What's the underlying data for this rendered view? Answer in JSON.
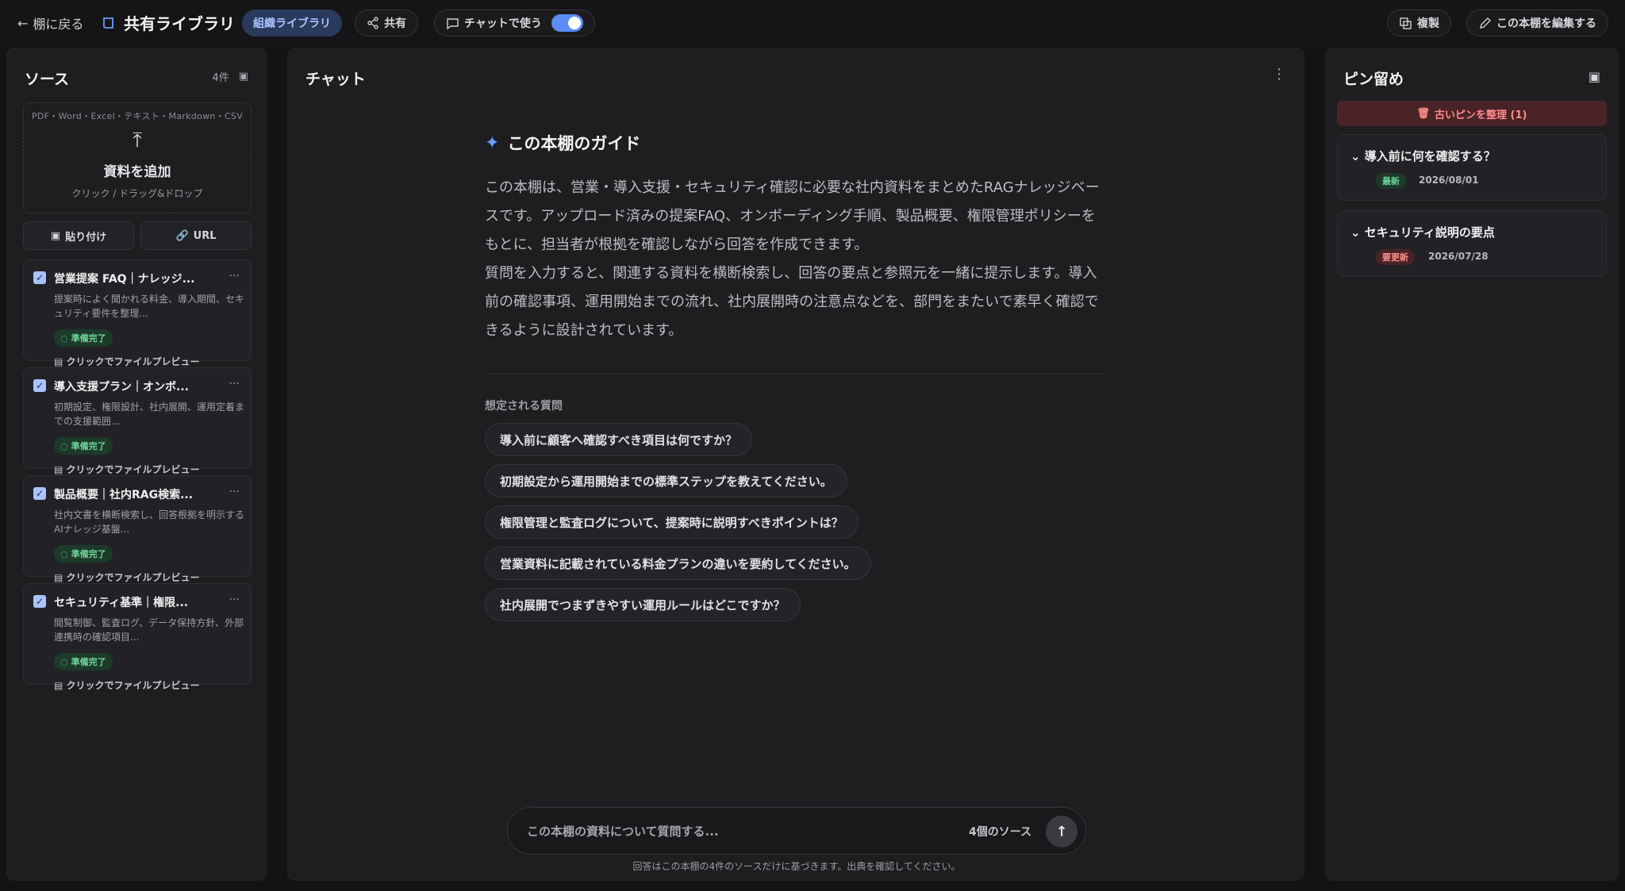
{
  "topbar": {
    "back_label": "棚に戻る",
    "title": "共有ライブラリ",
    "org_badge": "組織ライブラリ",
    "share_label": "共有",
    "chat_toggle_label": "チャットで使う",
    "duplicate_label": "複製",
    "edit_label": "この本棚を編集する"
  },
  "sources": {
    "heading": "ソース",
    "count": "4件",
    "upload_types": "PDF・Word・Excel・テキスト・Markdown・CSV",
    "upload_add": "資料を追加",
    "upload_hint": "クリック / ドラッグ&ドロップ",
    "paste_label": "貼り付け",
    "url_label": "URL",
    "items": [
      {
        "name": "営業提案 FAQ｜ナレッジ...",
        "desc": "提案時によく聞かれる料金、導入期間、セキュリティ要件を整理...",
        "status": "準備完了",
        "preview": "クリックでファイルプレビュー"
      },
      {
        "name": "導入支援プラン｜オンボ...",
        "desc": "初期設定、権限設計、社内展開、運用定着までの支援範囲...",
        "status": "準備完了",
        "preview": "クリックでファイルプレビュー"
      },
      {
        "name": "製品概要｜社内RAG検索...",
        "desc": "社内文書を横断検索し、回答根拠を明示するAIナレッジ基盤...",
        "status": "準備完了",
        "preview": "クリックでファイルプレビュー"
      },
      {
        "name": "セキュリティ基準｜権限...",
        "desc": "閲覧制御、監査ログ、データ保持方針、外部連携時の確認項目...",
        "status": "準備完了",
        "preview": "クリックでファイルプレビュー"
      }
    ]
  },
  "chat": {
    "heading": "チャット",
    "guide_title": "この本棚のガイド",
    "guide_text": "この本棚は、営業・導入支援・セキュリティ確認に必要な社内資料をまとめたRAGナレッジベースです。アップロード済みの提案FAQ、オンボーディング手順、製品概要、権限管理ポリシーをもとに、担当者が根拠を確認しながら回答を作成できます。\n質問を入力すると、関連する資料を横断検索し、回答の要点と参照元を一緒に提示します。導入前の確認事項、運用開始までの流れ、社内展開時の注意点などを、部門をまたいで素早く確認できるように設計されています。",
    "questions_label": "想定される質問",
    "questions": [
      "導入前に顧客へ確認すべき項目は何ですか？",
      "初期設定から運用開始までの標準ステップを教えてください。",
      "権限管理と監査ログについて、提案時に説明すべきポイントは？",
      "営業資料に記載されている料金プランの違いを要約してください。",
      "社内展開でつまずきやすい運用ルールはどこですか？"
    ],
    "input_placeholder": "この本棚の資料について質問する...",
    "source_count": "4個のソース",
    "footnote": "回答はこの本棚の4件のソースだけに基づきます。出典を確認してください。"
  },
  "pins": {
    "heading": "ピン留め",
    "clean_label": "古いピンを整理 (1)",
    "items": [
      {
        "title": "導入前に何を確認する？",
        "tag": "最新",
        "date": "2026/08/01"
      },
      {
        "title": "セキュリティ説明の要点",
        "tag": "要更新",
        "date": "2026/07/28"
      }
    ]
  },
  "colors": {
    "accent": "#5b8df5",
    "ready": "#6fd69a",
    "warning": "#ff8c8c"
  }
}
